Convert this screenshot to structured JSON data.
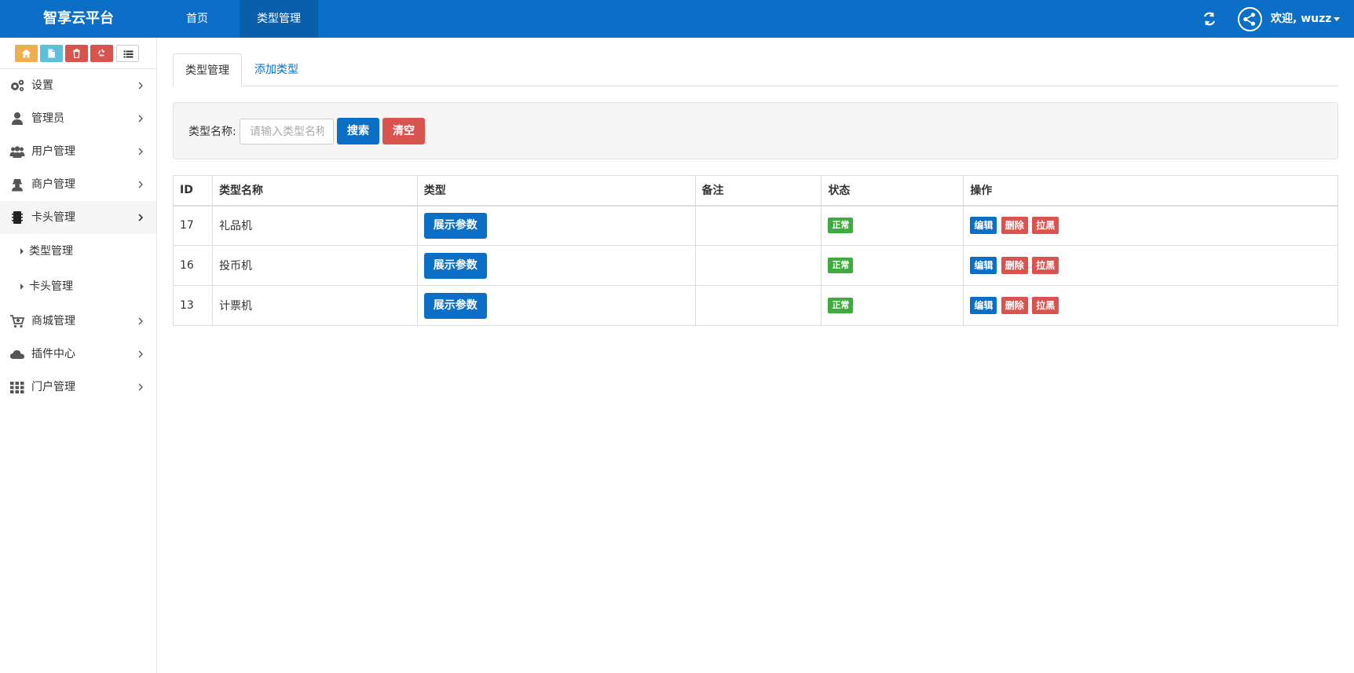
{
  "navbar": {
    "brand": "智享云平台",
    "links": [
      "首页",
      "类型管理"
    ],
    "user_label": "欢迎, wuzz"
  },
  "sidebar": {
    "shortcut_icons": [
      "home-icon",
      "file-icon",
      "trash-icon",
      "recycle-icon",
      "list-icon"
    ],
    "items": [
      {
        "label": "设置",
        "icon": "gears-icon"
      },
      {
        "label": "管理员",
        "icon": "user-icon"
      },
      {
        "label": "用户管理",
        "icon": "users-icon"
      },
      {
        "label": "商户管理",
        "icon": "merchant-icon"
      },
      {
        "label": "卡头管理",
        "icon": "card-reader-icon",
        "active": true
      },
      {
        "label": "商城管理",
        "icon": "cart-icon"
      },
      {
        "label": "插件中心",
        "icon": "cloud-icon"
      },
      {
        "label": "门户管理",
        "icon": "grid-icon"
      }
    ],
    "sub_items": [
      "类型管理",
      "卡头管理"
    ]
  },
  "tabs": [
    "类型管理",
    "添加类型"
  ],
  "search": {
    "label": "类型名称:",
    "placeholder": "请输入类型名称",
    "search_btn": "搜索",
    "clear_btn": "清空"
  },
  "table": {
    "headers": [
      "ID",
      "类型名称",
      "类型",
      "备注",
      "状态",
      "操作"
    ],
    "param_btn": "展示参数",
    "status_label": "正常",
    "actions": [
      "编辑",
      "删除",
      "拉黑"
    ],
    "rows": [
      {
        "id": "17",
        "name": "礼品机",
        "remark": "",
        "status": "正常"
      },
      {
        "id": "16",
        "name": "投币机",
        "remark": "",
        "status": "正常"
      },
      {
        "id": "13",
        "name": "计票机",
        "remark": "",
        "status": "正常"
      }
    ]
  },
  "colors": {
    "primary": "#0b6fc7",
    "danger": "#d9534f",
    "warning": "#f0ad4e",
    "info": "#5bc0de",
    "success": "#3fab3f"
  }
}
